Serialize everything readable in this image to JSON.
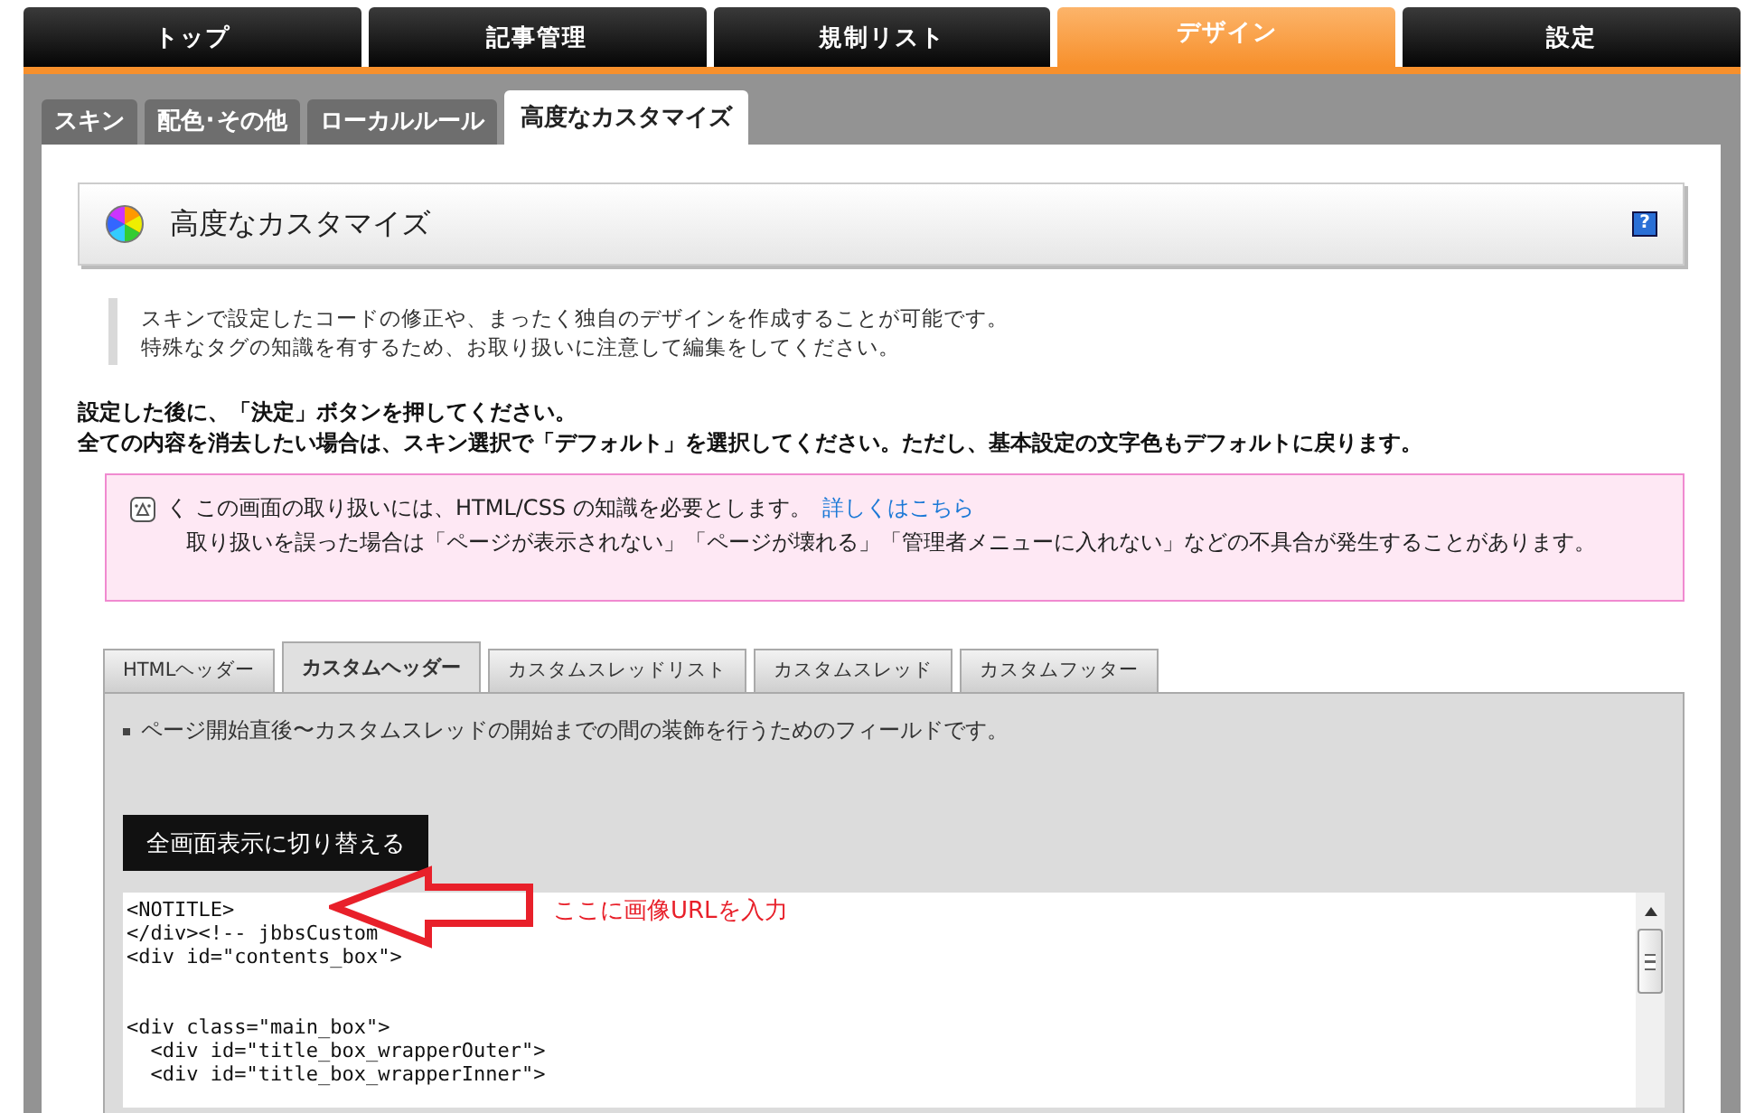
{
  "top_nav": [
    {
      "label": "トップ",
      "selected": false
    },
    {
      "label": "記事管理",
      "selected": false
    },
    {
      "label": "規制リスト",
      "selected": false
    },
    {
      "label": "デザイン",
      "selected": true
    },
    {
      "label": "設定",
      "selected": false
    }
  ],
  "sub_tabs": [
    {
      "label": "スキン",
      "selected": false
    },
    {
      "label": "配色･その他",
      "selected": false
    },
    {
      "label": "ローカルルール",
      "selected": false
    },
    {
      "label": "高度なカスタマイズ",
      "selected": true
    }
  ],
  "section": {
    "title": "高度なカスタマイズ",
    "help": "?"
  },
  "description": [
    "スキンで設定したコードの修正や、まったく独自のデザインを作成することが可能です。",
    "特殊なタグの知識を有するため、お取り扱いに注意して編集をしてください。"
  ],
  "instructions": [
    "設定した後に、「決定」ボタンを押してください。",
    "全ての内容を消去したい場合は、スキン選択で「デフォルト」を選択してください。ただし、基本設定の文字色もデフォルトに戻ります。"
  ],
  "warning": {
    "marker": "く",
    "text": "この画面の取り扱いには、HTML/CSS の知識を必要とします。",
    "link": "詳しくはこちら",
    "detail": "取り扱いを誤った場合は「ページが表示されない」「ページが壊れる」「管理者メニューに入れない」などの不具合が発生することがあります。"
  },
  "editor_tabs": [
    {
      "label": "HTMLヘッダー",
      "selected": false
    },
    {
      "label": "カスタムヘッダー",
      "selected": true
    },
    {
      "label": "カスタムスレッドリスト",
      "selected": false
    },
    {
      "label": "カスタムスレッド",
      "selected": false
    },
    {
      "label": "カスタムフッター",
      "selected": false
    }
  ],
  "field_note": "ページ開始直後〜カスタムスレッドの開始までの間の装飾を行うためのフィールドです。",
  "fullscreen_button": "全画面表示に切り替える",
  "code": "<NOTITLE>\n</div><!-- jbbsCustom\n<div id=\"contents_box\">\n\n\n<div class=\"main_box\">\n  <div id=\"title_box_wrapperOuter\">\n  <div id=\"title_box_wrapperInner\">",
  "annotation": "ここに画像URLを入力"
}
